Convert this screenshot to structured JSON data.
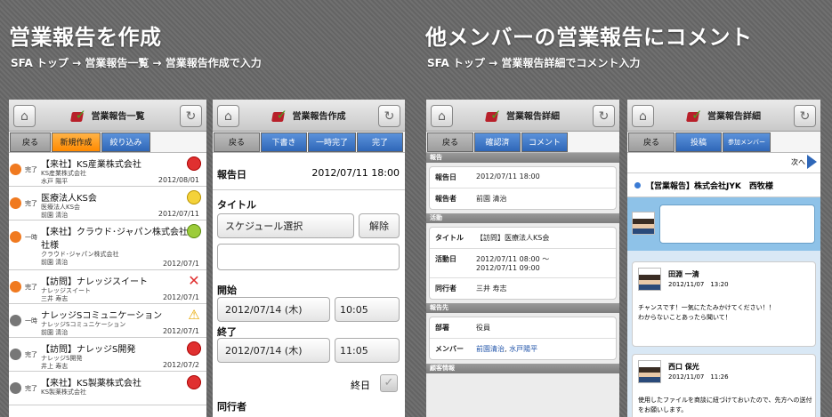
{
  "left": {
    "title": "営業報告を作成",
    "path": "SFA トップ → 営業報告一覧 → 営業報告作成で入力"
  },
  "right": {
    "title": "他メンバーの営業報告にコメント",
    "path": "SFA トップ → 営業報告詳細でコメント入力"
  },
  "s1": {
    "title": "営業報告一覧",
    "buttons": [
      "戻る",
      "新規作成",
      "絞り込み"
    ],
    "rows": [
      {
        "status": "完了",
        "dot": "#f07a20",
        "title": "【来社】KS産業株式会社",
        "sub1": "KS産業株式会社",
        "sub2": "水戸 陽平",
        "date": "2012/08/01",
        "icon": "red"
      },
      {
        "status": "完了",
        "dot": "#f07a20",
        "title": "医療法人KS会",
        "sub1": "医療法人KS会",
        "sub2": "前園 清治",
        "date": "2012/07/11",
        "icon": "yellow"
      },
      {
        "status": "一時",
        "dot": "#f07a20",
        "title": "【来社】クラウド･ジャパン株式会社",
        "title2": "社様",
        "sub1": "クラウド･ジャパン株式会社",
        "sub2": "前園 清治",
        "date": "2012/07/1",
        "icon": "green"
      },
      {
        "status": "完了",
        "dot": "#f07a20",
        "title": "【訪問】ナレッジスイート",
        "sub1": "ナレッジスイート",
        "sub2": "三井 寿志",
        "date": "2012/07/1",
        "icon": "x"
      },
      {
        "status": "一時",
        "dot": "#777",
        "title": "ナレッジSコミュニケーション",
        "sub1": "ナレッジSコミュニケーション",
        "sub2": "前園 清治",
        "date": "2012/07/1",
        "icon": "warn"
      },
      {
        "status": "完了",
        "dot": "#777",
        "title": "【訪問】ナレッジS開発",
        "sub1": "ナレッジS開発",
        "sub2": "井上 寿志",
        "date": "2012/07/2",
        "icon": "red"
      },
      {
        "status": "完了",
        "dot": "#777",
        "title": "【来社】KS製薬株式会社",
        "sub1": "KS製薬株式会社",
        "sub2": "",
        "date": "",
        "icon": "red"
      }
    ]
  },
  "s2": {
    "title": "営業報告作成",
    "buttons": [
      "戻る",
      "下書き",
      "一時完了",
      "完了"
    ],
    "date_label": "報告日",
    "date_value": "2012/07/11 18:00",
    "title_label": "タイトル",
    "schedule": "スケジュール選択",
    "release": "解除",
    "start_label": "開始",
    "start_date": "2012/07/14 (木)",
    "start_time": "10:05",
    "end_label": "終了",
    "end_date": "2012/07/14 (木)",
    "end_time": "11:05",
    "allday": "終日",
    "attendee": "同行者"
  },
  "s3": {
    "title": "営業報告詳細",
    "buttons": [
      "戻る",
      "確認済",
      "コメント"
    ],
    "sec1": "報告",
    "date_k": "報告日",
    "date_v": "2012/07/11 18:00",
    "rep_k": "報告者",
    "rep_v": "前園 清治",
    "sec2": "活動",
    "title_k": "タイトル",
    "title_v": "【訪問】医療法人KS会",
    "act_k": "活動日",
    "act_v1": "2012/07/11 08:00 ～",
    "act_v2": "2012/07/11 09:00",
    "comp_k": "同行者",
    "comp_v": "三井 寿志",
    "sec3": "報告先",
    "dept_k": "部署",
    "dept_v": "役員",
    "mem_k": "メンバー",
    "mem_v1": "前園清治",
    "mem_sep": ",",
    "mem_v2": "水戸陽平",
    "sec4": "顧客情報"
  },
  "s4": {
    "title": "営業報告詳細",
    "buttons": [
      "戻る",
      "投稿",
      "参加メンバー"
    ],
    "next": "次へ",
    "header": "【営業報告】株式会社JYK　西牧様",
    "c1_name": "田淵 一清",
    "c1_date": "2012/11/07　13:20",
    "c1_t1": "チャンスです！一気にたたみかけてください！！",
    "c1_t2": "わからないことあったら聞いて！",
    "c2_name": "西口 保光",
    "c2_date": "2012/11/07　11:26",
    "c2_t1": "使用したファイルを商談に紐づけておいたので、先方への送付",
    "c2_t2": "をお願いします。"
  }
}
